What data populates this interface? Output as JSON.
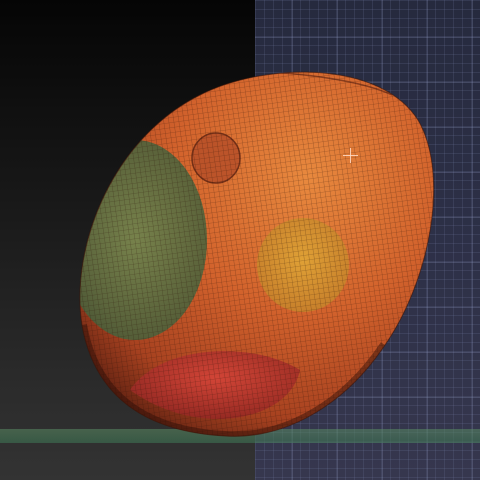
{
  "scene": {
    "object": "egg-mesh",
    "colors": {
      "egg_base": "#d85a2a",
      "egg_highlight": "#e48a3a",
      "green_spot": "#5a7a4a",
      "yellow_spot": "#d8a030",
      "red_spot": "#c83a30",
      "wire": "#2a1008",
      "grid_background": "#2d3047",
      "ground_line": "#4a8a60"
    }
  }
}
